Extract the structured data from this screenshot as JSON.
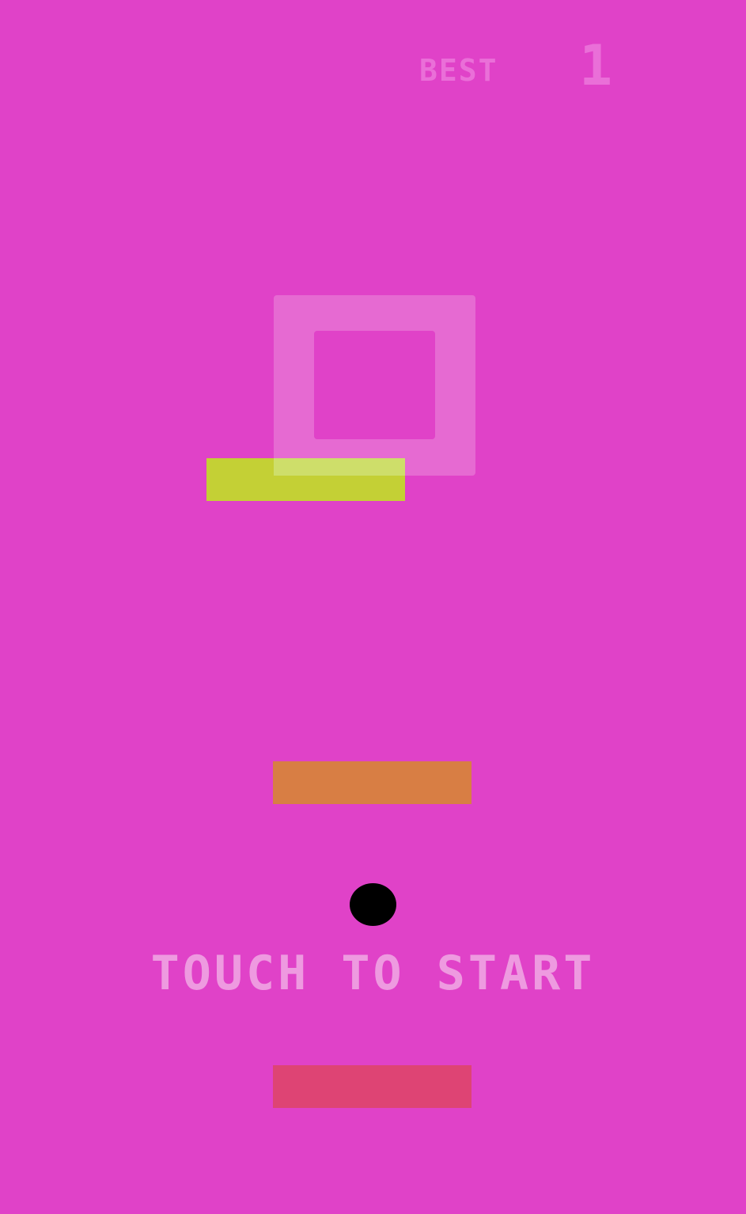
{
  "hud": {
    "best_label": "BEST",
    "best_value": "1"
  },
  "prompt": {
    "start_text": "TOUCH TO START"
  },
  "colors": {
    "background": "#e042c8",
    "target_frame": "#e66ad2",
    "platform_top": "#c4d035",
    "platform_middle": "#d87e44",
    "platform_bottom": "#de4474",
    "ball": "#000000",
    "hud_text": "#ea6fd8",
    "prompt_text": "#ee9ae0"
  }
}
